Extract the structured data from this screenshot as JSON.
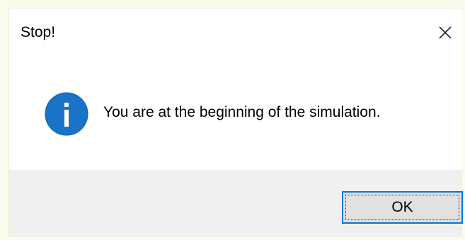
{
  "dialog": {
    "title": "Stop!",
    "close_icon": "close-icon",
    "message": "You are at the beginning of the simulation.",
    "icon": "info-icon",
    "ok_label": "OK"
  },
  "colors": {
    "info_icon": "#1a73c8",
    "accent": "#0078d7",
    "footer_bg": "#f0f0f0",
    "button_bg": "#e1e1e1"
  }
}
